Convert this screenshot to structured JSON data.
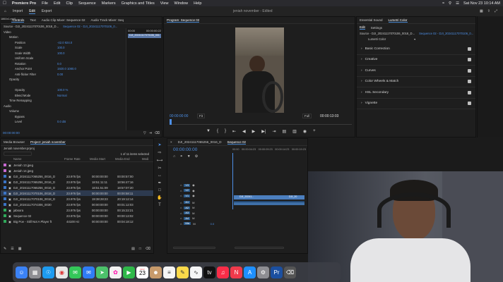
{
  "menubar": {
    "app_name": "Premiere Pro",
    "items": [
      "File",
      "Edit",
      "Clip",
      "Sequence",
      "Markers",
      "Graphics and Titles",
      "View",
      "Window",
      "Help"
    ],
    "clock": "Sat Nov 23  10:14 AM"
  },
  "header": {
    "tabs": [
      "Import",
      "Edit",
      "Export"
    ],
    "active_tab": "Edit",
    "project_title": "jeniah november",
    "project_status": "- Edited"
  },
  "source_panel": {
    "tabs": [
      "Effect Controls",
      "Text",
      "Audio Clip Mixer: Sequence 02",
      "Audio Track Mixer: Seq"
    ],
    "source_label": "Source - DJI_20241117070106_0018_D...",
    "seq_label": "Sequence 02 - DJI_20241117070106_0...",
    "time_start": "00:00",
    "time_end": "00:00:00:22",
    "clip_name": "DJI_20241117070106_001",
    "rows": [
      {
        "name": "Video",
        "value": "",
        "indent": 0
      },
      {
        "name": "Motion",
        "value": "",
        "indent": 1
      },
      {
        "name": "Position",
        "value": "-42.0    924.0",
        "indent": 2
      },
      {
        "name": "Scale",
        "value": "100.0",
        "indent": 2
      },
      {
        "name": "Scale Width",
        "value": "100.0",
        "indent": 2
      },
      {
        "name": "Uniform Scale",
        "value": "",
        "indent": 2
      },
      {
        "name": "Rotation",
        "value": "0.0",
        "indent": 2
      },
      {
        "name": "Anchor Point",
        "value": "1920.0    1080.0",
        "indent": 2
      },
      {
        "name": "Anti-flicker Filter",
        "value": "0.00",
        "indent": 2
      },
      {
        "name": "Opacity",
        "value": "",
        "indent": 1
      },
      {
        "name": "",
        "value": "",
        "indent": 2
      },
      {
        "name": "Opacity",
        "value": "100.0 %",
        "indent": 2
      },
      {
        "name": "Blend Mode",
        "value": "Normal",
        "indent": 2
      },
      {
        "name": "Time Remapping",
        "value": "",
        "indent": 1
      },
      {
        "name": "Audio",
        "value": "",
        "indent": 0
      },
      {
        "name": "Volume",
        "value": "",
        "indent": 1
      },
      {
        "name": "Bypass",
        "value": "",
        "indent": 2
      },
      {
        "name": "Level",
        "value": "0.0 dB",
        "indent": 2
      }
    ],
    "timecode": "00:00:00:00",
    "file_label": "1860x1.mp4"
  },
  "program_monitor": {
    "title": "Program: Sequence 02",
    "timecode": "00:00:00:00",
    "fit": "Fit",
    "quality": "Full",
    "duration": "00:00:13:03"
  },
  "project_panel": {
    "tabs": [
      "Media Browser",
      "Project: jeniah november"
    ],
    "project_file": "Jeniah november.prproj",
    "count": "1 of 11 items selected",
    "columns": [
      "Name",
      "Frame Rate",
      "Media Start",
      "Media End",
      "Medi"
    ],
    "items": [
      {
        "name": "Jeniah 13.jpeg",
        "fr": "",
        "ms": "",
        "me": "",
        "color": "#c76ad1"
      },
      {
        "name": "Jeniah 14.jpeg",
        "fr": "",
        "ms": "",
        "me": "",
        "color": "#c76ad1"
      },
      {
        "name": "DJI_20241117065256_0016_D",
        "fr": "23.976 fps",
        "ms": "00:00:00:00",
        "me": "00:00:57:00",
        "color": "#3b74c5"
      },
      {
        "name": "DJI_20241117065256_0016_D",
        "fr": "23.976 fps",
        "ms": "18:51:11:11",
        "me": "18:56:47:16",
        "color": "#3b74c5"
      },
      {
        "name": "DJI_20241117065256_0016_D",
        "fr": "23.976 fps",
        "ms": "18:51:51:09",
        "me": "18:57:07:20",
        "color": "#3b74c5"
      },
      {
        "name": "DJI_20241117070106_0018_D",
        "fr": "23.976 fps",
        "ms": "00:00:00:00",
        "me": "00:00:58:11",
        "color": "#3b74c5"
      },
      {
        "name": "DJI_20241117070106_0018_D",
        "fr": "23.976 fps",
        "ms": "19:38:28:23",
        "me": "20:19:12:14",
        "color": "#3b74c5"
      },
      {
        "name": "DJI_20241117074306_0030",
        "fr": "23.976 fps",
        "ms": "00:00:00:00",
        "me": "00:01:12:03",
        "color": "#3b74c5"
      },
      {
        "name": "jabsora",
        "fr": "23.976 fps",
        "ms": "00:00:00:00",
        "me": "00:15:22:21",
        "color": "#2fa85a"
      },
      {
        "name": "Sequence 02",
        "fr": "23.976 fps",
        "ms": "00:00:00:00",
        "me": "00:00:13:02",
        "color": "#2fa85a"
      },
      {
        "name": "Big Poe - Still Not A Player ft",
        "fr": "44100 Hz",
        "ms": "00:00:00:00",
        "me": "00:04:18:12",
        "color": "#2fa85a"
      }
    ]
  },
  "timeline": {
    "tab": "Sequence 02",
    "close_tab": "DJI_20241117065256_0016_D",
    "timecode": "00:00:00:00",
    "ruler": [
      "00:00",
      "00:00:04:23",
      "00:00:09:23",
      "00:00:14:23",
      "00:00:19:23"
    ],
    "tracks": [
      "V3",
      "V2",
      "V1",
      "A1",
      "A2",
      "A3",
      "A4",
      "Mix"
    ],
    "mix_value": "0.0",
    "clip_v1": "DJI_20241...",
    "clip_v1b": "DJI_20",
    "clip_a1": ""
  },
  "essential_panel": {
    "tabs": [
      "Essential Sound",
      "Lumetri Color"
    ],
    "subtabs": [
      "Edit",
      "Settings"
    ],
    "source_label": "Source - DJI_20241117070106_0018_D...",
    "seq_label": "Sequence 02 - DJI_20241117070106_0...",
    "preset": "Lumetri Color",
    "sections": [
      "Basic Correction",
      "Creative",
      "Curves",
      "Color Wheels & Match",
      "HSL Secondary",
      "Vignette"
    ]
  },
  "dock": {
    "calendar_month": "NOV",
    "calendar_day": "23"
  },
  "colors": {
    "accent": "#4a8ad4",
    "timecode": "#4d8fe6",
    "clip_video": "#4c7fbf",
    "clip_audio": "#3e6fa8"
  }
}
